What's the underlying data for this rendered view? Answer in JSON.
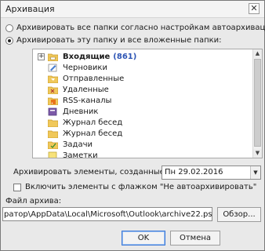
{
  "window": {
    "title": "Архивация",
    "close_glyph": "✕"
  },
  "options": {
    "archive_all": "Архивировать все папки согласно настройкам автоархивации",
    "archive_folder": "Архивировать эту папку и все вложенные папки:",
    "selected": "archive_folder"
  },
  "tree": {
    "items": [
      {
        "label": "Входящие",
        "count": "(861)",
        "icon": "inbox-folder-icon",
        "expander": "+"
      },
      {
        "label": "Черновики",
        "icon": "drafts-icon"
      },
      {
        "label": "Отправленные",
        "icon": "sent-icon"
      },
      {
        "label": "Удаленные",
        "icon": "deleted-icon"
      },
      {
        "label": "RSS-каналы",
        "icon": "rss-icon"
      },
      {
        "label": "Дневник",
        "icon": "journal-icon"
      },
      {
        "label": "Журнал бесед",
        "icon": "folder-icon"
      },
      {
        "label": "Журнал бесед",
        "icon": "folder-icon"
      },
      {
        "label": "Задачи",
        "icon": "tasks-icon"
      },
      {
        "label": "Заметки",
        "icon": "notes-icon"
      }
    ]
  },
  "archive_date": {
    "label": "Архивировать элементы, созданные до:",
    "value": "Пн 29.02.2016"
  },
  "no_autoarchive": {
    "label": "Включить элементы с флажком \"Не автоархивировать\"",
    "checked": false
  },
  "archive_file": {
    "label": "Файл архива:",
    "path": "ратор\\AppData\\Local\\Microsoft\\Outlook\\archive22.pst",
    "browse_label": "Обзор..."
  },
  "buttons": {
    "ok": "OK",
    "cancel": "Отмена"
  },
  "colors": {
    "accent": "#3b78d8",
    "count": "#2e55b5",
    "folder": "#f0c85a",
    "rss": "#e8731a"
  }
}
